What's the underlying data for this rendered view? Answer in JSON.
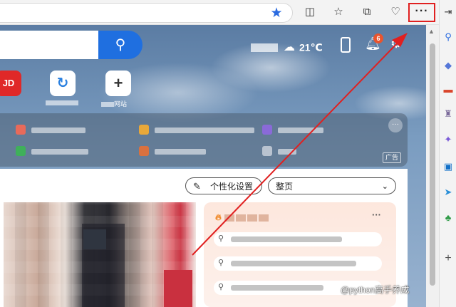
{
  "toolbar": {
    "more_label": "···",
    "icons": [
      "favorite-star-icon",
      "split-screen-icon",
      "favorites-icon",
      "collections-icon",
      "browser-essentials-icon",
      "more-menu-icon"
    ]
  },
  "header": {
    "temperature": "21℃",
    "notification_count": "6"
  },
  "shortcuts": [
    {
      "label": "JD"
    },
    {
      "label": ""
    },
    {
      "label": "+",
      "caption": "网站"
    }
  ],
  "ad_panel": {
    "ad_tag": "广告",
    "more_label": "···"
  },
  "feed": {
    "personalize_label": "个性化设置",
    "layout_label": "整页",
    "hot_more": "···"
  },
  "watermark": "@python高手养成",
  "colors": {
    "accent": "#1f6fe0",
    "highlight_box": "#e02020",
    "badge": "#e8542e"
  }
}
